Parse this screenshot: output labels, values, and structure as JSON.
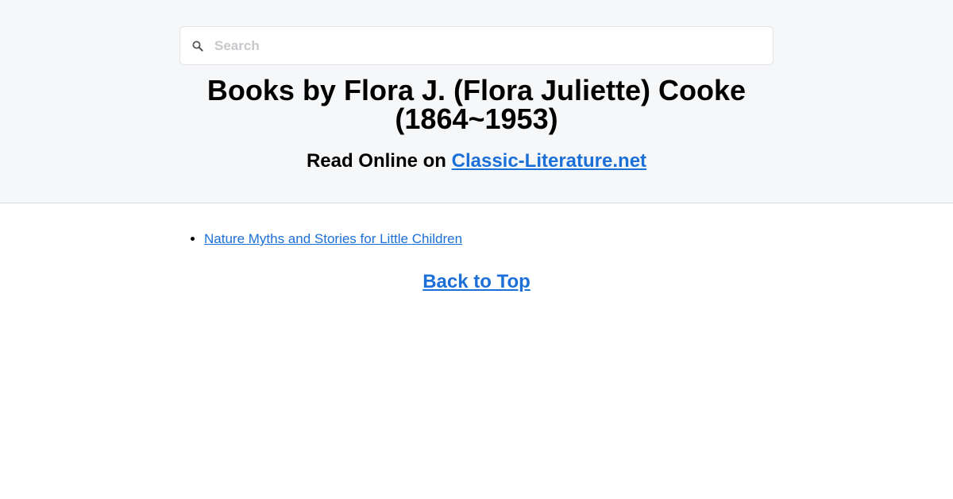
{
  "search": {
    "placeholder": "Search",
    "icon": "search-icon"
  },
  "header": {
    "title_line1": "Books by Flora J. (Flora Juliette) Cooke",
    "title_line2": "(1864~1953)",
    "subtitle_prefix": "Read Online on ",
    "subtitle_link": "Classic-Literature.net"
  },
  "books": [
    {
      "title": "Nature Myths and Stories for Little Children"
    }
  ],
  "footer": {
    "back_to_top": "Back to Top"
  },
  "colors": {
    "link": "#1a6fd8",
    "header_bg": "#f6f7f9"
  }
}
